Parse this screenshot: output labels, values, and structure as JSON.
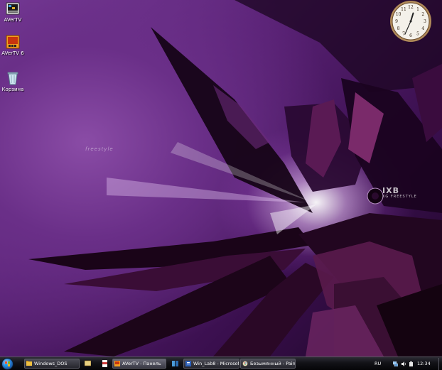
{
  "desktop_icons": [
    {
      "label": "AVerTV",
      "icon": "tv-icon"
    },
    {
      "label": "AVerTV 6",
      "icon": "tv-app-icon"
    },
    {
      "label": "Корзина",
      "icon": "recycle-bin-icon"
    }
  ],
  "wallpaper_text": {
    "brand": "IXB",
    "tagline": "XG FREESTYLE",
    "sign": "freestyle"
  },
  "clock_gadget": {
    "numbers": [
      "12",
      "1",
      "2",
      "3",
      "4",
      "5",
      "6",
      "7",
      "8",
      "9",
      "10",
      "11"
    ],
    "hour": 12,
    "minute": 34
  },
  "taskbar": {
    "start_icon": "windows-orb-icon",
    "buttons": [
      {
        "label": "Windows_DOS",
        "icon": "folder-icon"
      },
      {
        "label": "AVerTV - Панель",
        "icon": "tv-icon"
      },
      {
        "label": "Win_Lab8 - Microsof...",
        "icon": "word-icon"
      },
      {
        "label": "Безымянный - Paint",
        "icon": "paint-icon"
      }
    ],
    "quick_launch": [
      "show-desktop-icon",
      "media-icon",
      "switch-windows-icon"
    ]
  },
  "tray": {
    "language": "RU",
    "time": "12:34",
    "icons": [
      "network-icon",
      "volume-icon",
      "power-icon"
    ]
  },
  "colors": {
    "wallpaper_base": "#5a2276",
    "taskbar": "#121217",
    "label_text": "#ffffff"
  }
}
